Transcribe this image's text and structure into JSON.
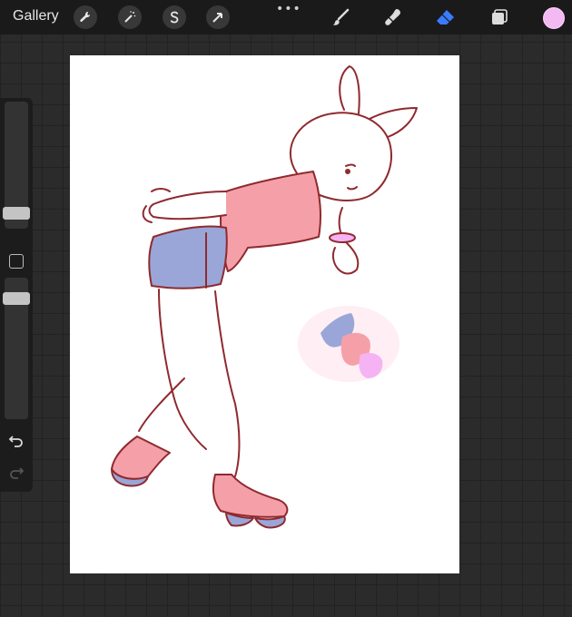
{
  "topbar": {
    "gallery_label": "Gallery",
    "tools": [
      {
        "icon": "wrench-icon",
        "name": "actions"
      },
      {
        "icon": "magic-wand-icon",
        "name": "adjustments"
      },
      {
        "icon": "selection-s-icon",
        "name": "selection"
      },
      {
        "icon": "arrow-cursor-icon",
        "name": "transform"
      }
    ],
    "more_label": "•••",
    "right_tools": [
      {
        "icon": "brush-icon",
        "name": "paint"
      },
      {
        "icon": "smudge-icon",
        "name": "smudge"
      },
      {
        "icon": "eraser-icon",
        "name": "erase",
        "active": true
      },
      {
        "icon": "layers-icon",
        "name": "layers"
      }
    ],
    "active_color": "#f3b9f3",
    "accent_color": "#3a7bff"
  },
  "sidebar": {
    "brush_size_level": 0.28,
    "opacity_level": 0.72,
    "undo_icon": "undo-icon",
    "redo_icon": "redo-icon"
  },
  "canvas": {
    "background": "#ffffff",
    "palette_colors": [
      "#f5a0a8",
      "#9aa6d8",
      "#f6b3f3",
      "#8f2a2f"
    ]
  }
}
